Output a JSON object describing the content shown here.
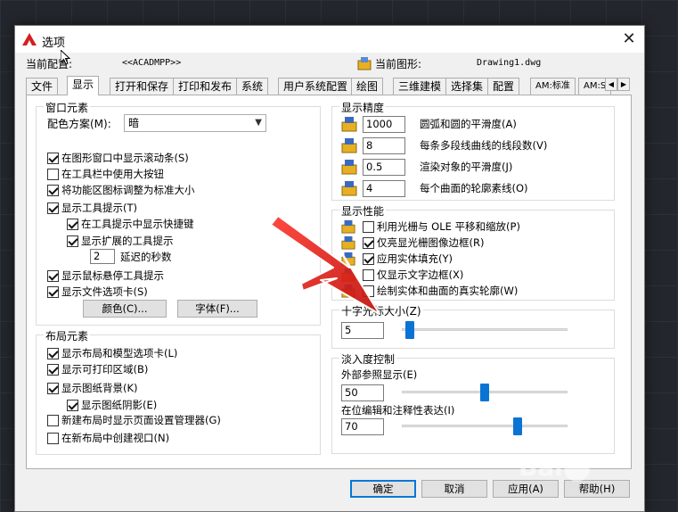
{
  "dialog": {
    "title": "选项",
    "current_profile_label": "当前配置:",
    "current_profile_value": "<<ACADMPP>>",
    "current_drawing_label": "当前图形:",
    "current_drawing_value": "Drawing1.dwg"
  },
  "tabs": [
    {
      "label": "文件",
      "active": false
    },
    {
      "label": "显示",
      "active": true
    },
    {
      "label": "打开和保存",
      "active": false
    },
    {
      "label": "打印和发布",
      "active": false
    },
    {
      "label": "系统",
      "active": false
    },
    {
      "label": "用户系统配置",
      "active": false
    },
    {
      "label": "绘图",
      "active": false
    },
    {
      "label": "三维建模",
      "active": false
    },
    {
      "label": "选择集",
      "active": false
    },
    {
      "label": "配置",
      "active": false
    },
    {
      "label": "AM:标准",
      "active": false
    },
    {
      "label": "AM:S",
      "active": false
    }
  ],
  "window_elements": {
    "title": "窗口元素",
    "color_scheme_label": "配色方案(M):",
    "color_scheme_value": "暗",
    "options": [
      {
        "label": "在图形窗口中显示滚动条(S)",
        "checked": true
      },
      {
        "label": "在工具栏中使用大按钮",
        "checked": false
      },
      {
        "label": "将功能区图标调整为标准大小",
        "checked": true
      },
      {
        "label": "显示工具提示(T)",
        "checked": true
      },
      {
        "label": "在工具提示中显示快捷键",
        "checked": true
      },
      {
        "label": "显示扩展的工具提示",
        "checked": true
      },
      {
        "label": "显示鼠标悬停工具提示",
        "checked": true
      },
      {
        "label": "显示文件选项卡(S)",
        "checked": true
      }
    ],
    "delay_value": "2",
    "delay_label": "延迟的秒数",
    "colors_button": "颜色(C)...",
    "fonts_button": "字体(F)..."
  },
  "layout_elements": {
    "title": "布局元素",
    "options": [
      {
        "label": "显示布局和模型选项卡(L)",
        "checked": true
      },
      {
        "label": "显示可打印区域(B)",
        "checked": true
      },
      {
        "label": "显示图纸背景(K)",
        "checked": true
      },
      {
        "label": "显示图纸阴影(E)",
        "checked": true
      },
      {
        "label": "新建布局时显示页面设置管理器(G)",
        "checked": false
      },
      {
        "label": "在新布局中创建视口(N)",
        "checked": false
      }
    ]
  },
  "display_resolution": {
    "title": "显示精度",
    "rows": [
      {
        "value": "1000",
        "label": "圆弧和圆的平滑度(A)"
      },
      {
        "value": "8",
        "label": "每条多段线曲线的线段数(V)"
      },
      {
        "value": "0.5",
        "label": "渲染对象的平滑度(J)"
      },
      {
        "value": "4",
        "label": "每个曲面的轮廓素线(O)"
      }
    ]
  },
  "display_performance": {
    "title": "显示性能",
    "options": [
      {
        "label": "利用光栅与 OLE 平移和缩放(P)",
        "checked": false
      },
      {
        "label": "仅亮显光栅图像边框(R)",
        "checked": true
      },
      {
        "label": "应用实体填充(Y)",
        "checked": true
      },
      {
        "label": "仅显示文字边框(X)",
        "checked": false
      },
      {
        "label": "绘制实体和曲面的真实轮廓(W)",
        "checked": false
      }
    ]
  },
  "crosshair": {
    "title": "十字光标大小(Z)",
    "value": "5",
    "level": 5
  },
  "fade_control": {
    "title": "淡入度控制",
    "xref_label": "外部参照显示(E)",
    "xref_value": "50",
    "xref_level": 50,
    "inplace_label": "在位编辑和注释性表达(I)",
    "inplace_value": "70",
    "inplace_level": 70
  },
  "buttons": {
    "ok": "确定",
    "cancel": "取消",
    "apply": "应用(A)",
    "help": "帮助(H)"
  },
  "colors": {
    "accent": "#0078d7",
    "slider": "#0a74d4",
    "arrow": "#e0201c"
  }
}
